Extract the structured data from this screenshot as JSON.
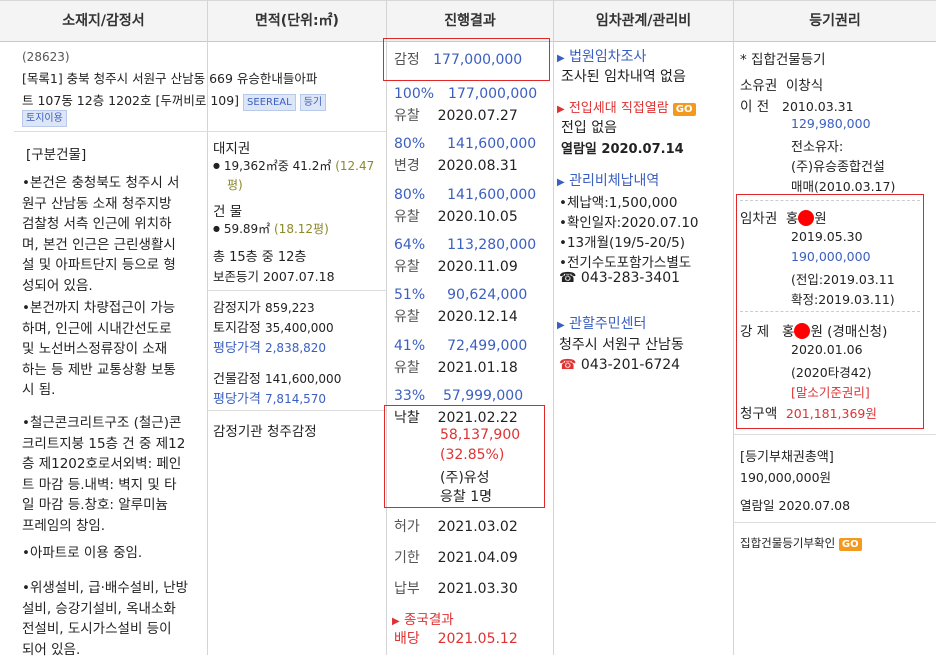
{
  "headers": [
    "소재지/감정서",
    "면적(단위:㎡)",
    "진행결과",
    "임차관계/관리비",
    "등기권리"
  ],
  "col1": {
    "postal": "(28623)",
    "address_line1": "[목록1] 충북 청주시 서원구 산남동 669 유승한내들아파",
    "address_line2": "트 107동 12층 1202호 [두꺼비로 109]",
    "tag_seereal": "SEEREAL",
    "tag_registry": "등기",
    "tag_land": "토지이용",
    "section_title": "[구분건물]",
    "paragraphs": [
      [
        "•본건은 충청북도 청주시 서",
        "원구 산남동 소재 청주지방",
        "검찰청 서측 인근에 위치하",
        "며, 본건 인근은 근린생활시",
        "설 및 아파트단지 등으로 형",
        "성되어 있음."
      ],
      [
        "•본건까지 차량접근이 가능",
        "하며, 인근에 시내간선도로",
        "및 노선버스정류장이 소재",
        "하는 등 제반 교통상황 보통",
        "시 됨."
      ],
      [
        "•철근콘크리트구조 (철근)콘",
        "크리트지붕 15층 건 중 제12",
        "층 제1202호로서외벽: 페인",
        "트 마감 등.내벽: 벽지 및 타",
        "일 마감 등.창호: 알루미늄",
        "프레임의 창임."
      ],
      [
        "•아파트로 이용 중임."
      ],
      [
        "•위생설비, 급·배수설비, 난방",
        "설비, 승강기설비, 옥내소화",
        "전설비, 도시가스설비 등이",
        "되어 있음."
      ]
    ]
  },
  "col2": {
    "land_title": "대지권",
    "land_area": "19,362㎡중 41.2㎡",
    "land_pyeong1": "(12.47",
    "land_pyeong2": "평)",
    "bldg_title": "건 물",
    "bldg_area": "59.89㎡",
    "bldg_pyeong": "(18.12평)",
    "floors": "총 15층 중 12층",
    "preserved": "보존등기 2007.07.18",
    "appraisal_label": "감정지가",
    "appraisal_val": "859,223",
    "land_apr_label": "토지감정",
    "land_apr_val": "35,400,000",
    "avg_label1": "평당가격",
    "avg_val1": "2,838,820",
    "bldg_apr_label": "건물감정",
    "bldg_apr_val": "141,600,000",
    "avg_label2": "평당가격",
    "avg_val2": "7,814,570",
    "org_label": "감정기관",
    "org_val": "청주감정"
  },
  "col3": {
    "appraisal_label": "감정",
    "appraisal_val": "177,000,000",
    "rounds": [
      {
        "pct": "100%",
        "price": "177,000,000",
        "status": "유찰",
        "date": "2020.07.27"
      },
      {
        "pct": "80%",
        "price": "141,600,000",
        "status": "변경",
        "date": "2020.08.31"
      },
      {
        "pct": "80%",
        "price": "141,600,000",
        "status": "유찰",
        "date": "2020.10.05"
      },
      {
        "pct": "64%",
        "price": "113,280,000",
        "status": "유찰",
        "date": "2020.11.09"
      },
      {
        "pct": "51%",
        "price": "90,624,000",
        "status": "유찰",
        "date": "2020.12.14"
      },
      {
        "pct": "41%",
        "price": "72,499,000",
        "status": "유찰",
        "date": "2021.01.18"
      }
    ],
    "last_pct": "33%",
    "last_price": "57,999,000",
    "sold_label": "낙찰",
    "sold_date": "2021.02.22",
    "sold_price": "58,137,900",
    "sold_pct": "(32.85%)",
    "buyer": "(주)유성",
    "bidders": "응찰 1명",
    "permit_label": "허가",
    "permit_date": "2021.03.02",
    "deadline_label": "기한",
    "deadline_date": "2021.04.09",
    "paid_label": "납부",
    "paid_date": "2021.03.30",
    "final_title": "종국결과",
    "dist_label": "배당",
    "dist_date": "2021.05.12"
  },
  "col4": {
    "court_survey": "법원임차조사",
    "no_lease": "조사된 임차내역 없음",
    "moved_in_title": "전입세대 직접열람",
    "go": "GO",
    "no_moved": "전입 없음",
    "view_label": "열람일",
    "view_date": "2020.07.14",
    "mgmt_title": "관리비체납내역",
    "mgmt_lines": [
      "체납액:1,500,000",
      "확인일자:2020.07.10",
      "13개월(19/5-20/5)",
      "전기수도포함가스별도"
    ],
    "mgmt_phone": "043-283-3401",
    "center_title": "관할주민센터",
    "center_name": "청주시 서원구 산남동",
    "center_phone": "043-201-6724"
  },
  "col5": {
    "title": "* 집합건물등기",
    "owner_label1": "소유권",
    "owner_name": "이창식",
    "owner_label2": "이  전",
    "owner_date": "2010.03.31",
    "owner_amount": "129,980,000",
    "prev_owner_label": "전소유자:",
    "prev_owner": "(주)유승종합건설",
    "sale": "매매(2010.03.17)",
    "lease_label": "임차권",
    "lease_name_a": "홍",
    "lease_name_b": "원",
    "lease_date": "2019.05.30",
    "lease_amount": "190,000,000",
    "lease_move": "(전입:2019.03.11",
    "lease_fixed": "확정:2019.03.11)",
    "forced_label": "강  제",
    "forced_name_a": "홍",
    "forced_name_b": "원 (경매신청)",
    "forced_date": "2020.01.06",
    "forced_case": "(2020타경42)",
    "forced_base": "[말소기준권리]",
    "claim_label": "청구액",
    "claim_amount": "201,181,369원",
    "total_title": "[등기부채권총액]",
    "total_amount": "190,000,000원",
    "view_label": "열람일",
    "view_date": "2020.07.08",
    "confirm": "집합건물등기부확인",
    "go": "GO"
  }
}
